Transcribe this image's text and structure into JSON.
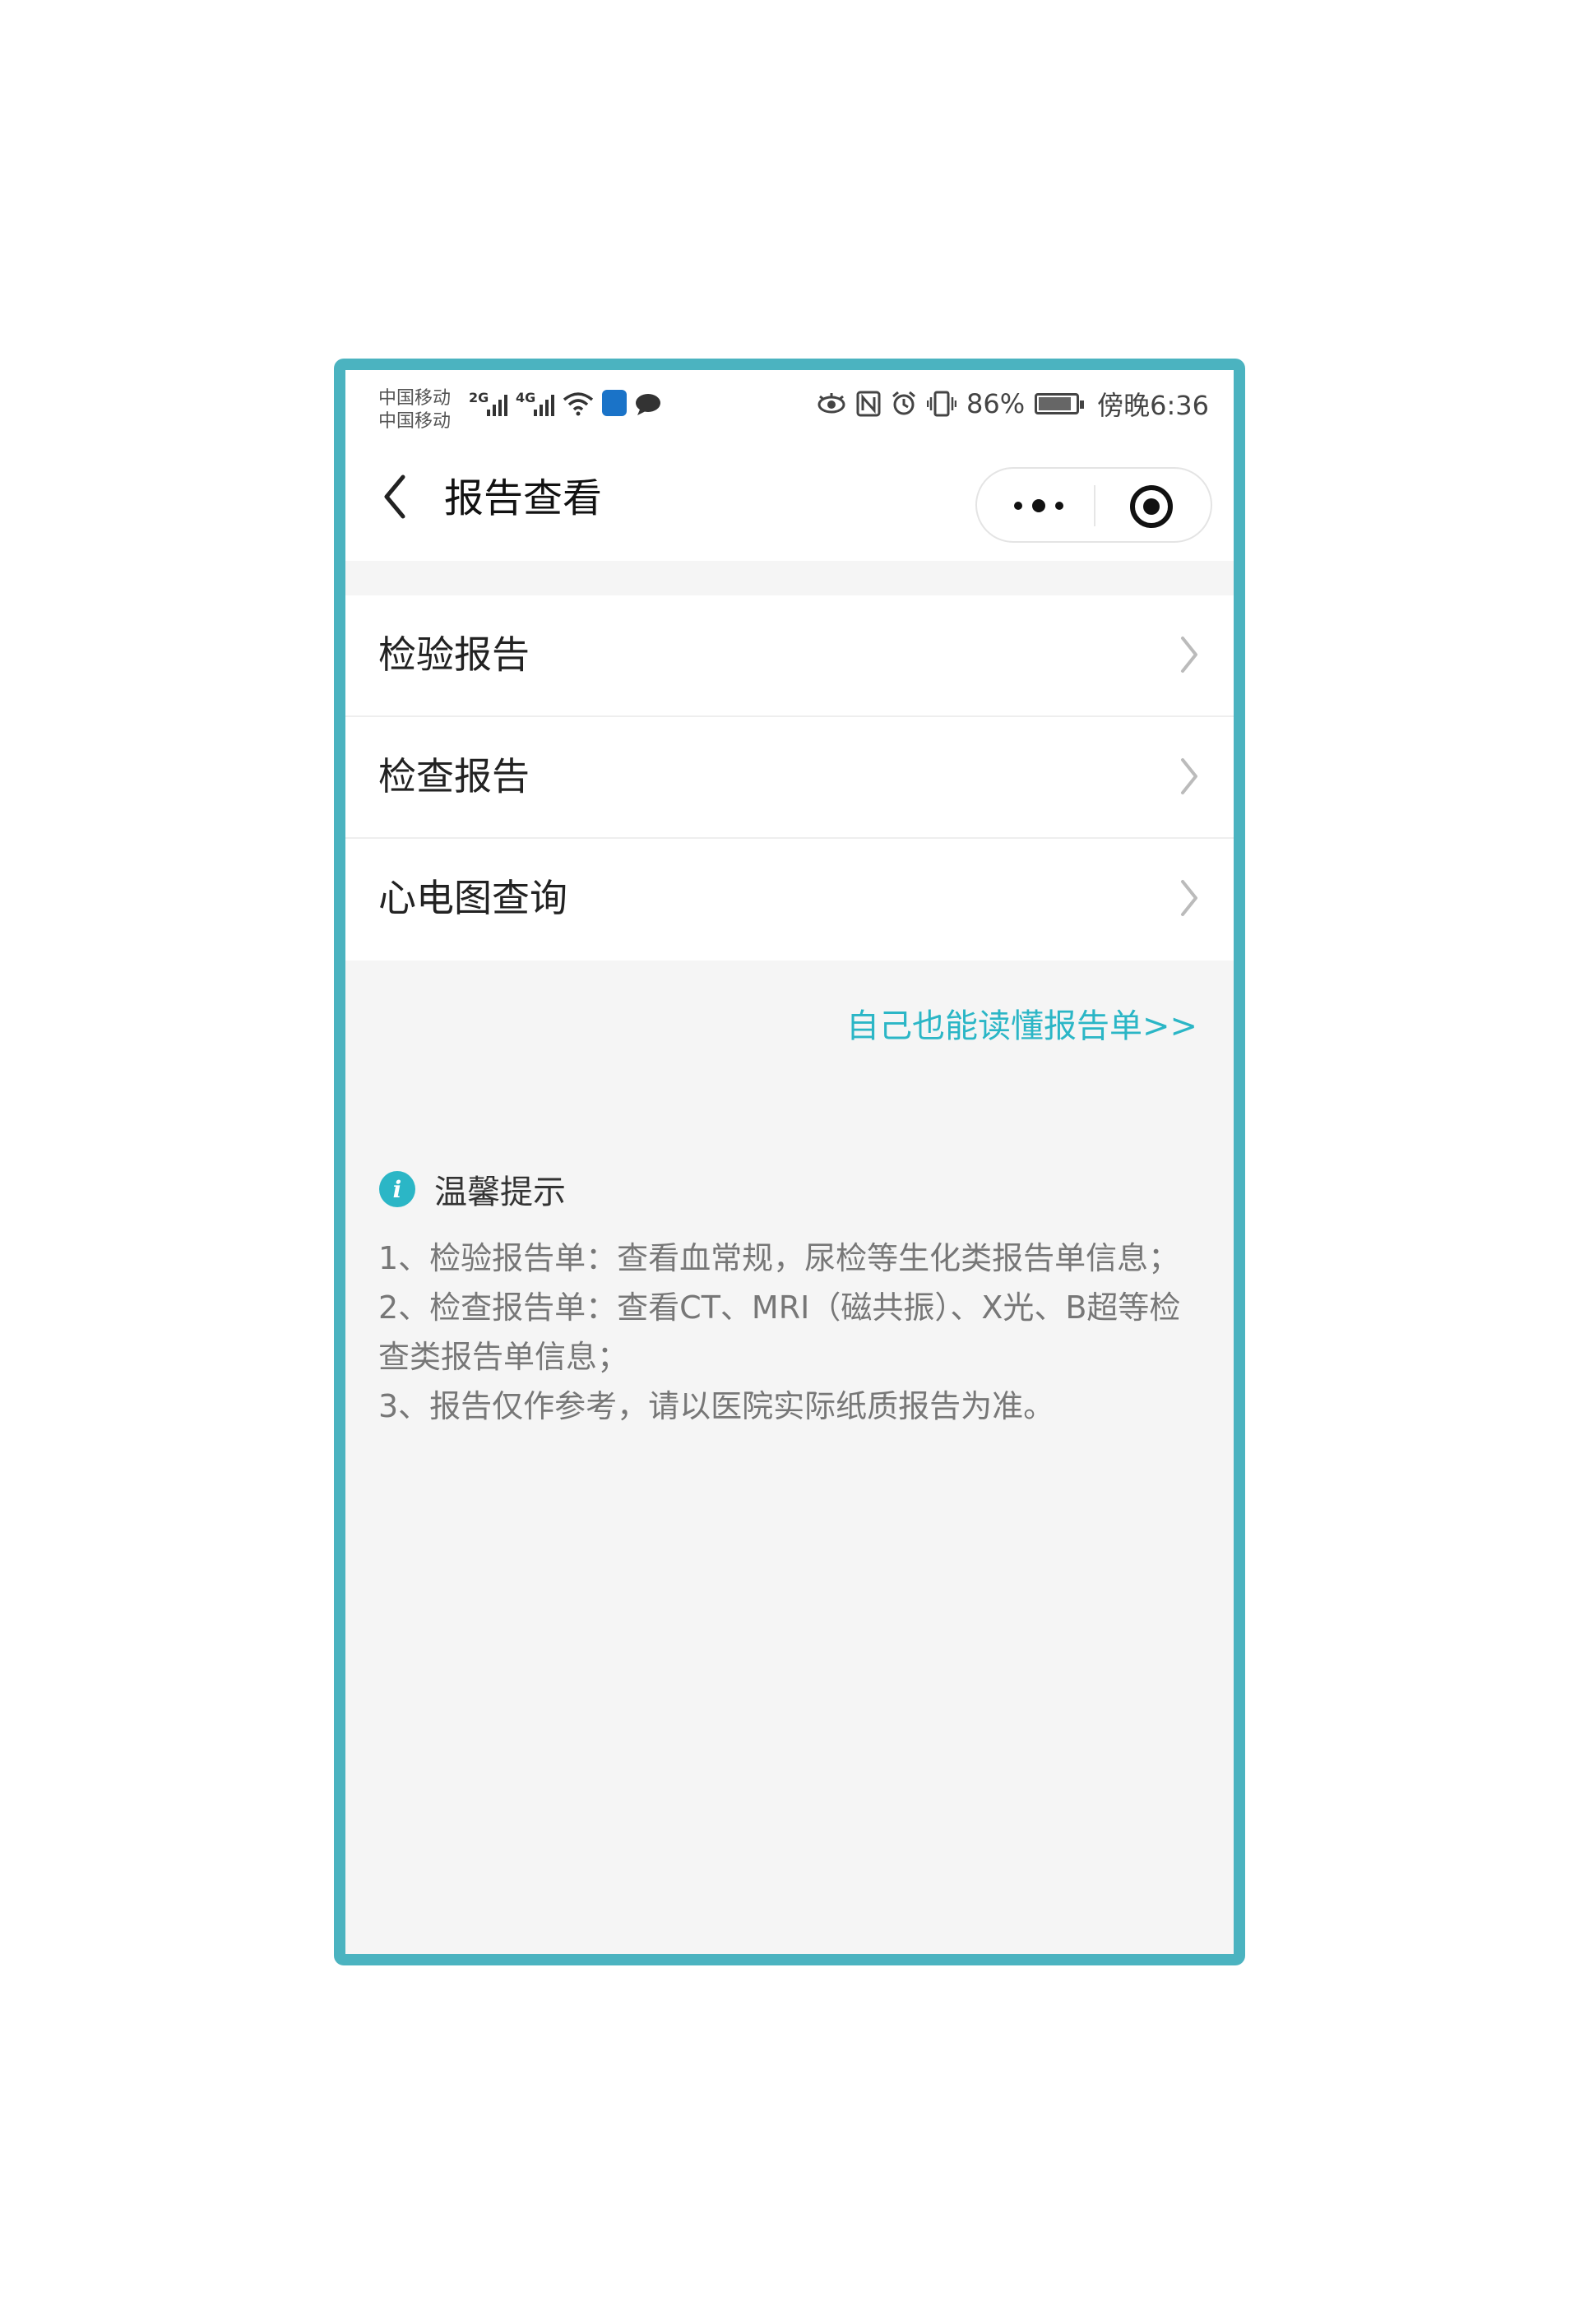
{
  "status_bar": {
    "carrier_1": "中国移动",
    "carrier_2": "中国移动",
    "sig1_tag": "2G",
    "sig2_tag": "4G",
    "battery_pct": "86%",
    "time": "傍晚6:36"
  },
  "nav": {
    "title": "报告查看"
  },
  "menu": {
    "items": [
      {
        "label": "检验报告"
      },
      {
        "label": "检查报告"
      },
      {
        "label": "心电图查询"
      }
    ]
  },
  "read_link": "自己也能读懂报告单>>",
  "tips": {
    "title": "温馨提示",
    "line1": "1、检验报告单：查看血常规，尿检等生化类报告单信息；",
    "line2": "2、检查报告单：查看CT、MRI（磁共振）、X光、B超等检查类报告单信息；",
    "line3": "3、报告仅作参考，请以医院实际纸质报告为准。"
  },
  "colors": {
    "accent": "#2bb6c6",
    "frame": "#4bb3c0"
  }
}
